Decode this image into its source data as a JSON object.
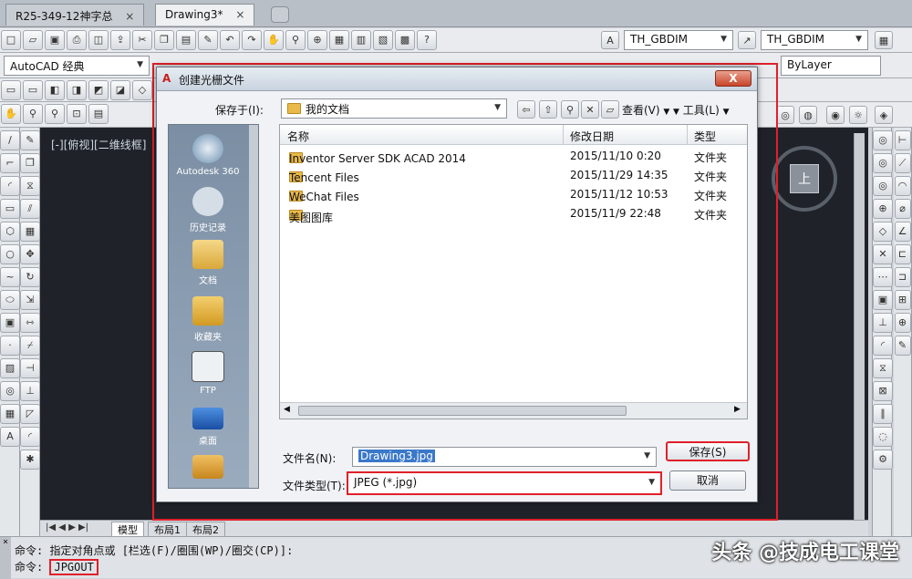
{
  "tabs": [
    {
      "label": "R25-349-12神字总"
    },
    {
      "label": "Drawing3*"
    }
  ],
  "toolbar": {
    "style_combo_1": "TH_GBDIM",
    "style_combo_2": "TH_GBDIM",
    "workspace_combo": "AutoCAD 经典",
    "layer_combo": "ByLayer"
  },
  "viewport_label": "[-][俯视][二维线框]",
  "navcube_label": "上",
  "layout_tabs": [
    "模型",
    "布局1",
    "布局2"
  ],
  "dialog": {
    "title": "创建光栅文件",
    "close_label": "X",
    "save_in_label": "保存于(I):",
    "save_in_value": "我的文档",
    "views_label": "查看(V)",
    "tools_label": "工具(L)",
    "places": [
      {
        "label": "Autodesk 360",
        "icon": "cloud-icon"
      },
      {
        "label": "历史记录",
        "icon": "history-icon"
      },
      {
        "label": "文档",
        "icon": "documents-icon"
      },
      {
        "label": "收藏夹",
        "icon": "favorites-icon"
      },
      {
        "label": "FTP",
        "icon": "ftp-icon"
      },
      {
        "label": "桌面",
        "icon": "desktop-icon"
      },
      {
        "label": "",
        "icon": "buzzsaw-icon"
      }
    ],
    "columns": {
      "name": "名称",
      "date": "修改日期",
      "type": "类型"
    },
    "files": [
      {
        "name": "Inventor Server SDK ACAD 2014",
        "date": "2015/11/10 0:20",
        "type": "文件夹"
      },
      {
        "name": "Tencent Files",
        "date": "2015/11/29 14:35",
        "type": "文件夹"
      },
      {
        "name": "WeChat Files",
        "date": "2015/11/12 10:53",
        "type": "文件夹"
      },
      {
        "name": "美图图库",
        "date": "2015/11/9 22:48",
        "type": "文件夹"
      }
    ],
    "filename_label": "文件名(N):",
    "filename_value": "Drawing3.jpg",
    "filetype_label": "文件类型(T):",
    "filetype_value": "JPEG (*.jpg)",
    "save_label": "保存(S)",
    "cancel_label": "取消"
  },
  "command": {
    "line1_prompt": "命令:",
    "line1_text": "指定对角点或 [栏选(F)/圈围(WP)/圈交(CP)]:",
    "line2_prompt": "命令:",
    "line2_value": "JPGOUT"
  },
  "watermark": "头条 @技成电工课堂",
  "colors": {
    "highlight": "#e0202a",
    "drawing_bg": "#1f2329"
  }
}
